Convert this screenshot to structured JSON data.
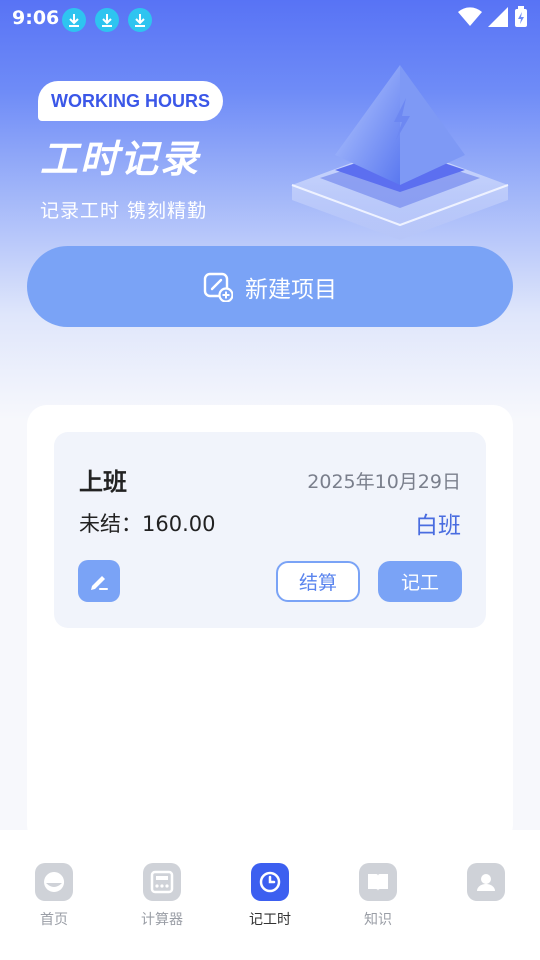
{
  "status_bar": {
    "time": "9:06"
  },
  "hero": {
    "badge": "WORKING HOURS",
    "title": "工时记录",
    "subtitle": "记录工时  镌刻精勤"
  },
  "new_project": {
    "label": "新建项目",
    "icon": "new-note-icon"
  },
  "projects": [
    {
      "title": "上班",
      "date": "2025年10月29日",
      "unsettled": "未结：160.00",
      "shift": "白班",
      "settle_label": "结算",
      "record_label": "记工"
    }
  ],
  "tabbar": {
    "active": 2,
    "tabs": [
      {
        "label": "首页",
        "icon": "home-icon"
      },
      {
        "label": "计算器",
        "icon": "calculator-icon"
      },
      {
        "label": "记工时",
        "icon": "clock-icon"
      },
      {
        "label": "知识",
        "icon": "book-icon"
      },
      {
        "label": "",
        "icon": "profile-icon"
      }
    ]
  },
  "colors": {
    "accent": "#7aa3f6",
    "active_tab": "#3c5ff0",
    "download_badge": "#2ec4f0"
  }
}
